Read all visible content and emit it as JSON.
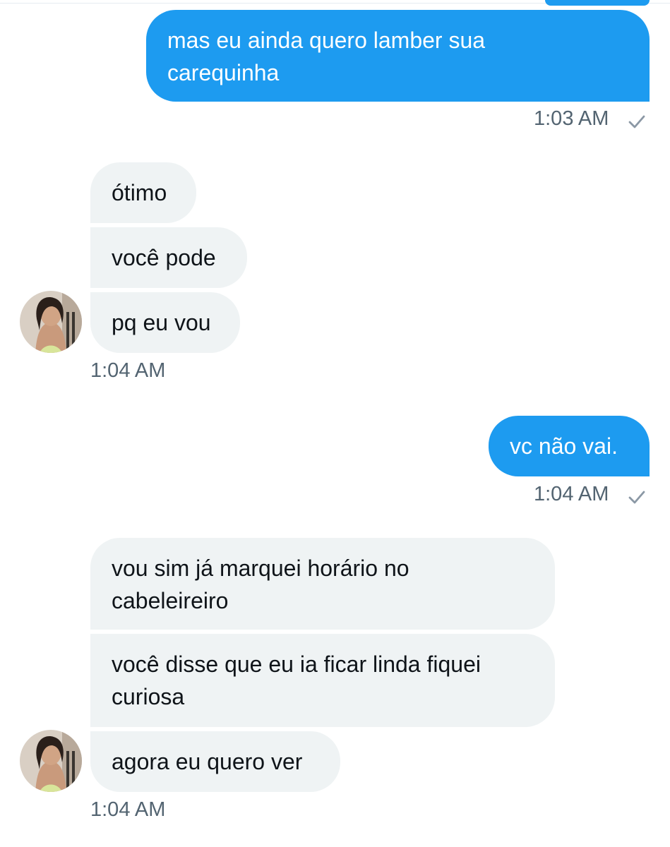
{
  "conversation": {
    "messages": [
      {
        "id": "m1",
        "direction": "outgoing",
        "text": "mas eu ainda quero lamber sua\ncarequinha"
      },
      {
        "id": "m2",
        "direction": "incoming",
        "text": "ótimo"
      },
      {
        "id": "m3",
        "direction": "incoming",
        "text": "você pode"
      },
      {
        "id": "m4",
        "direction": "incoming",
        "text": "pq eu vou"
      },
      {
        "id": "m5",
        "direction": "outgoing",
        "text": "vc não vai."
      },
      {
        "id": "m6",
        "direction": "incoming",
        "text": "vou sim já marquei horário no\ncabeleireiro"
      },
      {
        "id": "m7",
        "direction": "incoming",
        "text": "você disse que eu ia ficar linda fiquei\ncuriosa"
      },
      {
        "id": "m8",
        "direction": "incoming",
        "text": "agora eu quero ver"
      }
    ],
    "timestamps": {
      "t1": "1:03 AM",
      "t2": "1:04 AM",
      "t3": "1:04 AM",
      "t4": "1:04 AM"
    },
    "icons": {
      "read_receipt": "checkmark-icon",
      "contact_avatar": "avatar"
    }
  },
  "colors": {
    "outgoing_bubble": "#1d9bf0",
    "incoming_bubble": "#eff3f4",
    "timestamp_text": "#536471",
    "message_text": "#0f1419"
  }
}
